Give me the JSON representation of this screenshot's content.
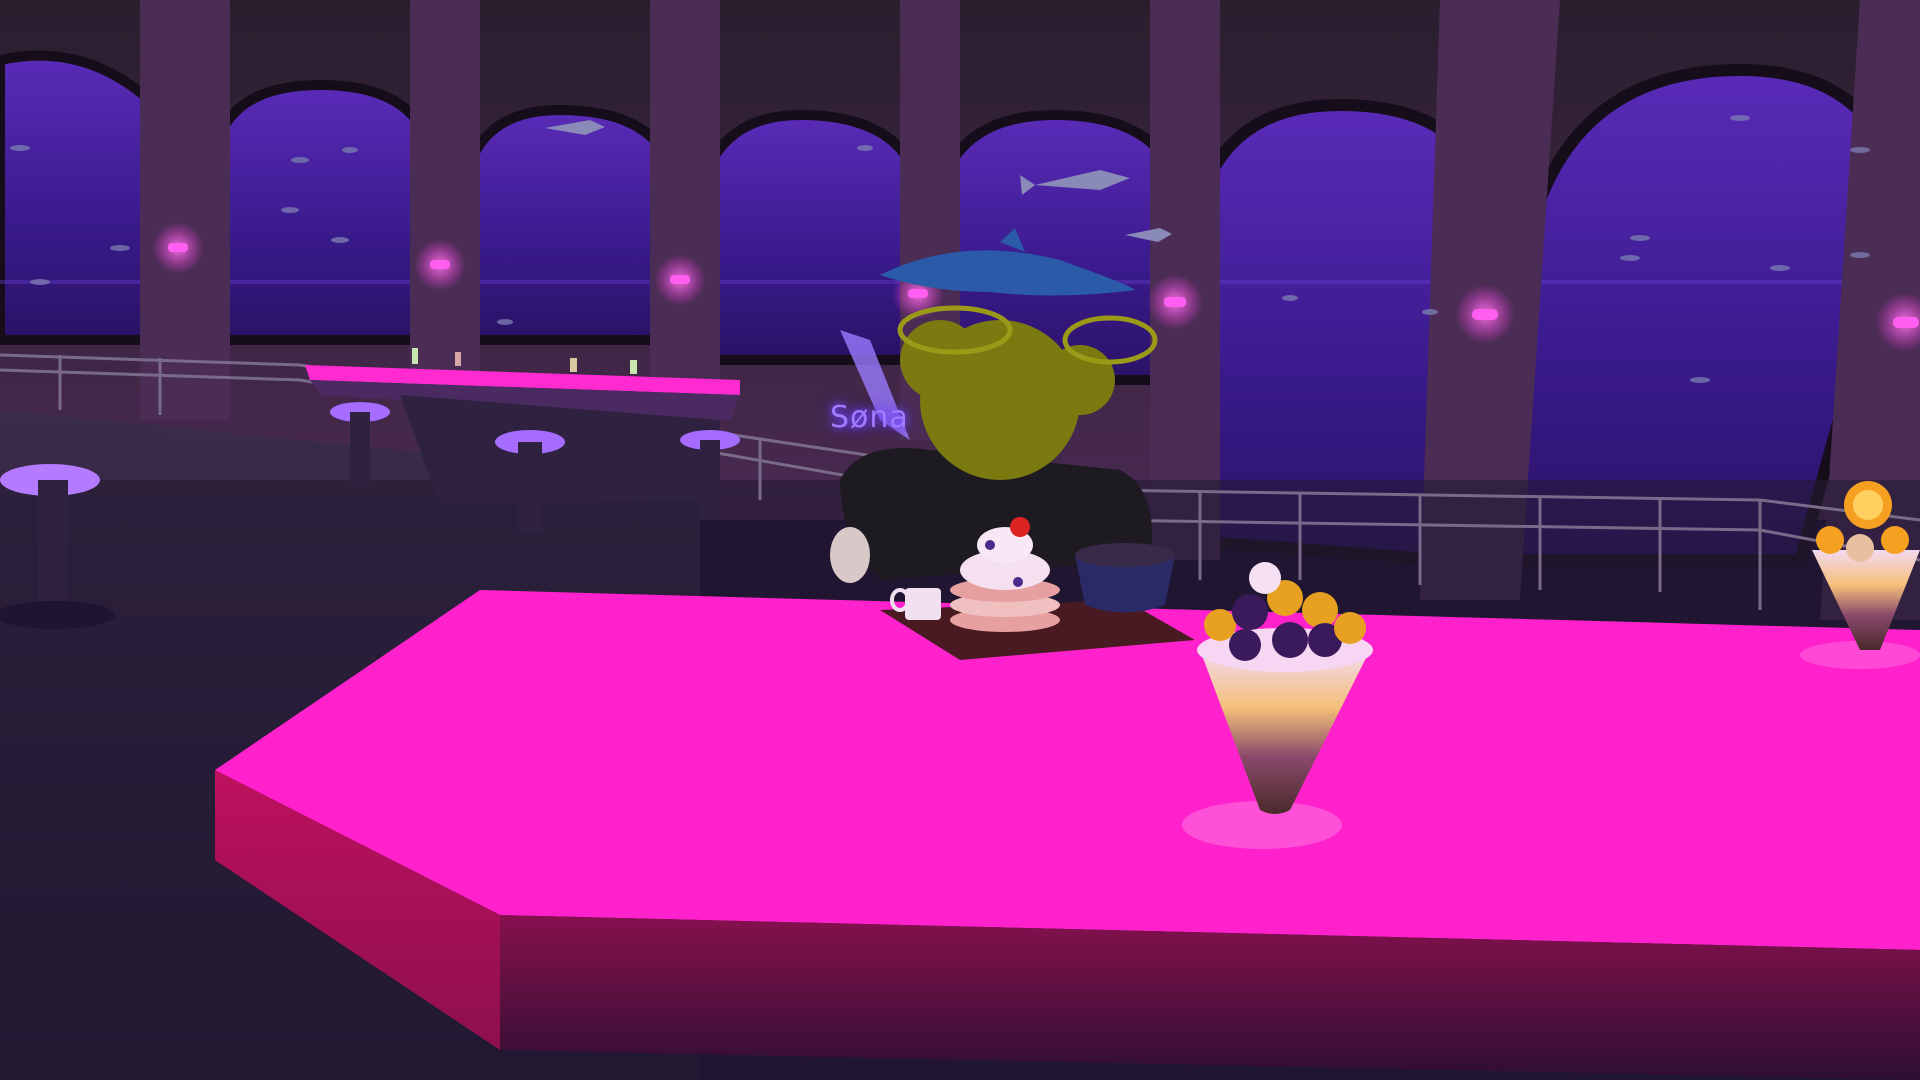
{
  "player": {
    "nametag": "Søna"
  },
  "colors": {
    "counter_top": "#ff22cc",
    "neon_accent": "#ff3be0",
    "ocean": "#3b1b8f",
    "wall": "#3a2540",
    "floor": "#2a1f3d",
    "avatar": "#7a7a10"
  },
  "icons": [
    "sundae-icon",
    "pancake-stack-icon",
    "coffee-mug-icon",
    "shark-icon",
    "dolphin-icon",
    "wall-lamp-icon"
  ]
}
